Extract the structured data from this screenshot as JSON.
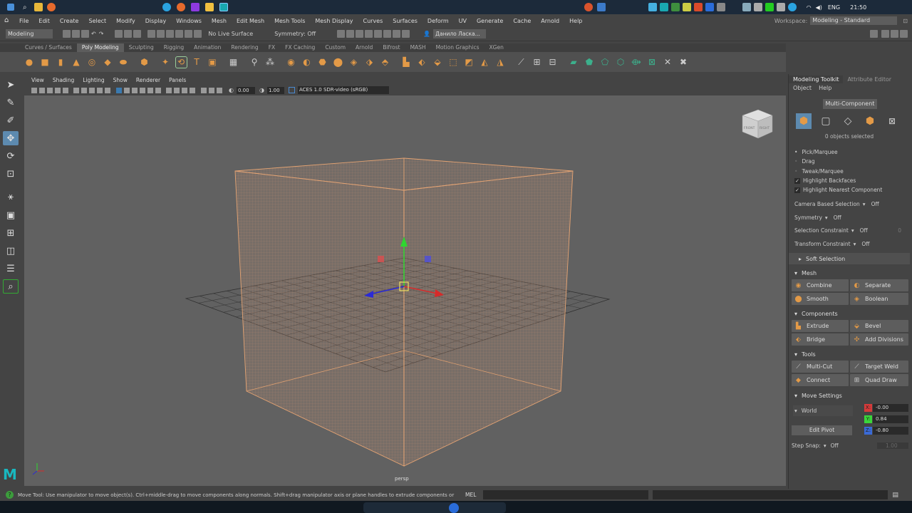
{
  "taskbar": {
    "time": "21:50",
    "lang": "ENG"
  },
  "menubar": {
    "items": [
      "File",
      "Edit",
      "Create",
      "Select",
      "Modify",
      "Display",
      "Windows",
      "Mesh",
      "Edit Mesh",
      "Mesh Tools",
      "Mesh Display",
      "Curves",
      "Surfaces",
      "Deform",
      "UV",
      "Generate",
      "Cache",
      "Arnold",
      "Help"
    ],
    "workspace_label": "Workspace:",
    "workspace_value": "Modeling - Standard"
  },
  "statusline": {
    "mode": "Modeling",
    "live_surface": "No Live Surface",
    "symmetry": "Symmetry: Off",
    "user": "Данило Ласка..."
  },
  "shelf": {
    "tabs": [
      "Curves / Surfaces",
      "Poly Modeling",
      "Sculpting",
      "Rigging",
      "Animation",
      "Rendering",
      "FX",
      "FX Caching",
      "Custom",
      "Arnold",
      "Bifrost",
      "MASH",
      "Motion Graphics",
      "XGen"
    ],
    "active_tab": "Poly Modeling"
  },
  "viewport": {
    "menus": [
      "View",
      "Shading",
      "Lighting",
      "Show",
      "Renderer",
      "Panels"
    ],
    "exposure": "0.00",
    "gamma": "1.00",
    "colorspace": "ACES 1.0 SDR-video (sRGB)",
    "camera": "persp",
    "cube_front": "FRONT",
    "cube_right": "RIGHT"
  },
  "right_panel": {
    "tabs": [
      "Modeling Toolkit",
      "Attribute Editor"
    ],
    "submenu": [
      "Object",
      "Help"
    ],
    "multi_component": "Multi-Component",
    "objects_selected": "0 objects selected",
    "options": [
      "Pick/Marquee",
      "Drag",
      "Tweak/Marquee"
    ],
    "checks": [
      "Highlight Backfaces",
      "Highlight Nearest Component"
    ],
    "camera_based": "Camera Based Selection",
    "camera_based_value": "Off",
    "symmetry": "Symmetry",
    "symmetry_value": "Off",
    "sel_constraint": "Selection Constraint",
    "sel_constraint_value": "Off",
    "sel_constraint_num": "0",
    "trans_constraint": "Transform Constraint",
    "trans_constraint_value": "Off",
    "soft_selection": "Soft Selection",
    "mesh": {
      "title": "Mesh",
      "buttons": [
        "Combine",
        "Separate",
        "Smooth",
        "Boolean"
      ]
    },
    "components": {
      "title": "Components",
      "buttons": [
        "Extrude",
        "Bevel",
        "Bridge",
        "Add Divisions"
      ]
    },
    "tools": {
      "title": "Tools",
      "buttons": [
        "Multi-Cut",
        "Target Weld",
        "Connect",
        "Quad Draw"
      ]
    },
    "move_settings": {
      "title": "Move Settings",
      "space": "World",
      "x": "-0.00",
      "y": "0.84",
      "z": "-0.80",
      "edit_pivot": "Edit Pivot",
      "step_snap": "Step Snap:",
      "step_snap_value": "Off",
      "step_snap_num": "1.00"
    }
  },
  "cmdline": {
    "help": "Move Tool: Use manipulator to move object(s). Ctrl+middle-drag to move components along normals. Shift+drag manipulator axis or plane handles to extrude components or clone objects. Ctrl+Shift+drag to c",
    "mel": "MEL"
  },
  "colors": {
    "accent": "#e39a47",
    "selected": "#5d8aaf",
    "wire": "#e8a572"
  }
}
